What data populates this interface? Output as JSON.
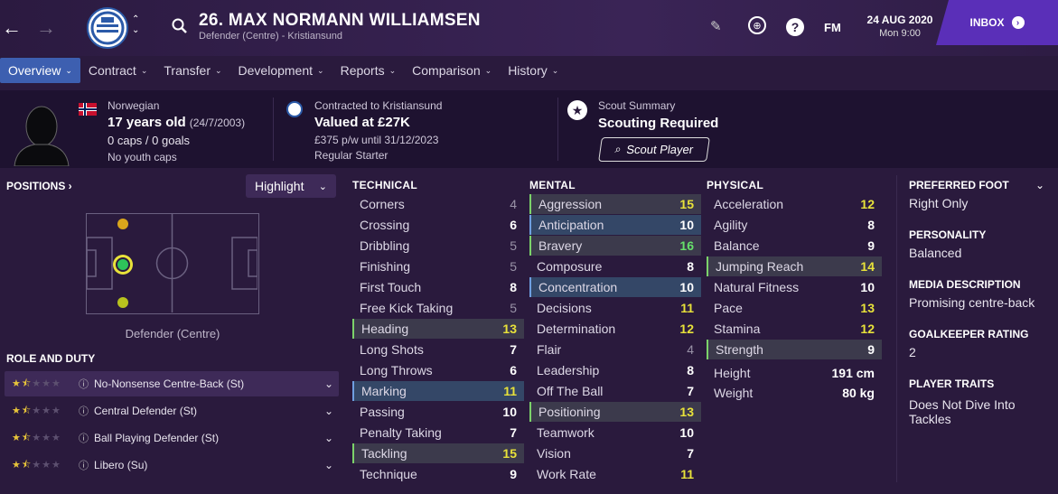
{
  "header": {
    "player_title": "26. MAX NORMANN WILLIAMSEN",
    "subtitle": "Defender (Centre) - Kristiansund",
    "date": "24 AUG 2020",
    "time": "Mon 9:00",
    "fm_label": "FM",
    "inbox_label": "INBOX"
  },
  "nav": {
    "tabs": [
      "Overview",
      "Contract",
      "Transfer",
      "Development",
      "Reports",
      "Comparison",
      "History"
    ]
  },
  "info": {
    "nationality": "Norwegian",
    "age": "17 years old",
    "dob": "(24/7/2003)",
    "caps": "0 caps / 0 goals",
    "youth_caps": "No youth caps",
    "contract_title": "Contracted to Kristiansund",
    "value": "Valued at £27K",
    "wage": "£375 p/w until 31/12/2023",
    "squad_status": "Regular Starter",
    "scout_title": "Scout Summary",
    "scout_status": "Scouting Required",
    "scout_button": "Scout Player"
  },
  "positions": {
    "title": "POSITIONS",
    "highlight_label": "Highlight",
    "position_label": "Defender (Centre)"
  },
  "roles": {
    "title": "ROLE AND DUTY",
    "items": [
      {
        "label": "No-Nonsense Centre-Back (St)",
        "stars": 1.5
      },
      {
        "label": "Central Defender (St)",
        "stars": 1.5
      },
      {
        "label": "Ball Playing Defender (St)",
        "stars": 1.5
      },
      {
        "label": "Libero (Su)",
        "stars": 1.5
      }
    ]
  },
  "technical": {
    "title": "TECHNICAL",
    "rows": [
      {
        "name": "Corners",
        "value": "4"
      },
      {
        "name": "Crossing",
        "value": "6"
      },
      {
        "name": "Dribbling",
        "value": "5"
      },
      {
        "name": "Finishing",
        "value": "5"
      },
      {
        "name": "First Touch",
        "value": "8"
      },
      {
        "name": "Free Kick Taking",
        "value": "5"
      },
      {
        "name": "Heading",
        "value": "13"
      },
      {
        "name": "Long Shots",
        "value": "7"
      },
      {
        "name": "Long Throws",
        "value": "6"
      },
      {
        "name": "Marking",
        "value": "11"
      },
      {
        "name": "Passing",
        "value": "10"
      },
      {
        "name": "Penalty Taking",
        "value": "7"
      },
      {
        "name": "Tackling",
        "value": "15"
      },
      {
        "name": "Technique",
        "value": "9"
      }
    ]
  },
  "mental": {
    "title": "MENTAL",
    "rows": [
      {
        "name": "Aggression",
        "value": "15"
      },
      {
        "name": "Anticipation",
        "value": "10"
      },
      {
        "name": "Bravery",
        "value": "16"
      },
      {
        "name": "Composure",
        "value": "8"
      },
      {
        "name": "Concentration",
        "value": "10"
      },
      {
        "name": "Decisions",
        "value": "11"
      },
      {
        "name": "Determination",
        "value": "12"
      },
      {
        "name": "Flair",
        "value": "4"
      },
      {
        "name": "Leadership",
        "value": "8"
      },
      {
        "name": "Off The Ball",
        "value": "7"
      },
      {
        "name": "Positioning",
        "value": "13"
      },
      {
        "name": "Teamwork",
        "value": "10"
      },
      {
        "name": "Vision",
        "value": "7"
      },
      {
        "name": "Work Rate",
        "value": "11"
      }
    ]
  },
  "physical": {
    "title": "PHYSICAL",
    "rows": [
      {
        "name": "Acceleration",
        "value": "12"
      },
      {
        "name": "Agility",
        "value": "8"
      },
      {
        "name": "Balance",
        "value": "9"
      },
      {
        "name": "Jumping Reach",
        "value": "14"
      },
      {
        "name": "Natural Fitness",
        "value": "10"
      },
      {
        "name": "Pace",
        "value": "13"
      },
      {
        "name": "Stamina",
        "value": "12"
      },
      {
        "name": "Strength",
        "value": "9"
      }
    ],
    "height_label": "Height",
    "height": "191 cm",
    "weight_label": "Weight",
    "weight": "80 kg"
  },
  "sidebar": {
    "foot_title": "PREFERRED FOOT",
    "foot": "Right Only",
    "personality_title": "PERSONALITY",
    "personality": "Balanced",
    "media_title": "MEDIA DESCRIPTION",
    "media": "Promising centre-back",
    "gk_title": "GOALKEEPER RATING",
    "gk": "2",
    "traits_title": "PLAYER TRAITS",
    "traits": "Does Not Dive Into Tackles"
  },
  "colors": {
    "accent": "#5a2fb8",
    "nav_active": "#3d5fb0",
    "good": "#e8e23a",
    "great": "#66e06a"
  }
}
